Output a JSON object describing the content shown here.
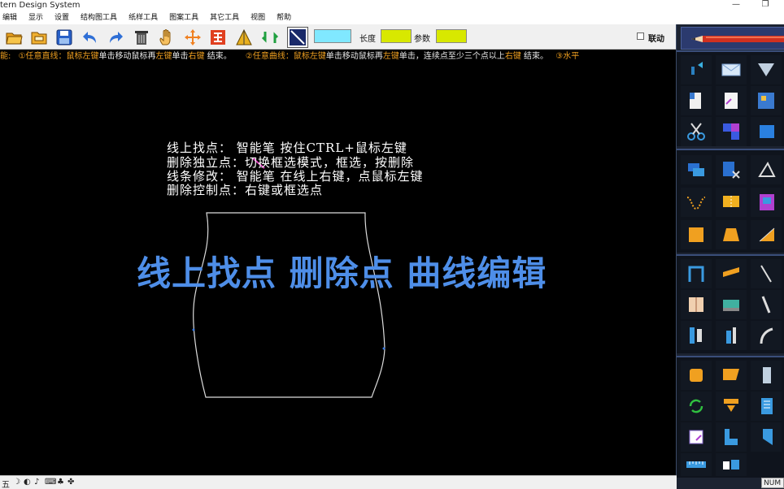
{
  "window": {
    "title": "tern Design System",
    "minimize": "—",
    "restore": "❐"
  },
  "menu": [
    "编辑",
    "显示",
    "设置",
    "结构图工具",
    "纸样工具",
    "图案工具",
    "其它工具",
    "视图",
    "帮助"
  ],
  "toolbar": {
    "buttons": [
      "open-folder",
      "open-folder-alt",
      "save",
      "undo",
      "redo",
      "delete",
      "hand-pan",
      "move-cross",
      "align-tool",
      "fold-tool",
      "rotate-tool",
      "line-style"
    ],
    "line_color": "#80e8ff",
    "length_label": "长度",
    "length_color": "#d8e800",
    "param_label": "参数",
    "param_color": "#d8e800",
    "link_label": "联动"
  },
  "hint": {
    "prefix": "能:",
    "p1_a": "①任意直线：鼠标",
    "p1_left": "左键",
    "p1_b": "单击移动鼠标再",
    "p1_left2": "左键",
    "p1_c": "单击",
    "p1_right": "右键",
    "p1_d": " 结束。",
    "p2_a": "②任意曲线：鼠标",
    "p2_left": "左键",
    "p2_b": "单击移动鼠标再",
    "p2_left2": "左键",
    "p2_c": "单击，连续点至少三个点以上",
    "p2_right": "右键",
    "p2_d": " 结束。",
    "p3": "③水平"
  },
  "instructions": [
    "线上找点：  智能笔  按住CTRL+鼠标左键",
    "删除独立点：切换框选模式，框选，按删除",
    "线条修改：  智能笔  在线上右键，点鼠标左键",
    "删除控制点：右键或框选点"
  ],
  "overlay_title": "线上找点 删除点 曲线编辑",
  "palette": {
    "groups": [
      [
        "smart-pen-icon",
        "envelope-icon",
        "triangle-icon",
        "paper-pattern-icon",
        "paper-edit-icon",
        "grid-pattern-icon",
        "scissors-icon",
        "puzzle-icon",
        "blue-square-icon"
      ],
      [
        "overlap-squares-icon",
        "cut-paper-icon",
        "triangle-outline-icon",
        "curve-icon",
        "fold-rect-icon",
        "gradient-rect-icon",
        "orange-square-icon",
        "trapezoid-icon",
        "half-triangle-icon"
      ],
      [
        "arch-icon",
        "ruler-tilted-icon",
        "needle-icon",
        "book-icon",
        "sewing-machine-icon",
        "bar-icon",
        "split-bars-icon",
        "pencil-mark-icon",
        "curve-line-icon"
      ],
      [
        "orange-cube-icon",
        "flag-icon",
        "column-icon",
        "refresh-icon",
        "arrow-down-icon",
        "panel-icon",
        "pattern-check-icon",
        "step-icon",
        "slant-icon"
      ]
    ]
  },
  "status": {
    "icons": [
      "五",
      "☽",
      "◐",
      "♪",
      "⌨",
      "♣",
      "✤"
    ],
    "num": "NUM"
  }
}
